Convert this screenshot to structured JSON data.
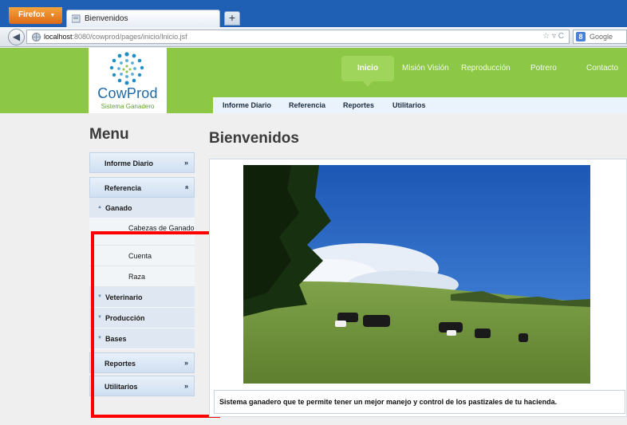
{
  "browser": {
    "app_button": "Firefox",
    "tab_title": "Bienvenidos",
    "new_tab": "+",
    "url_host": "localhost",
    "url_path": ":8080/cowprod/pages/inicio/Inicio.jsf",
    "search_placeholder": "Google"
  },
  "site": {
    "logo_title": "CowProd",
    "logo_subtitle": "Sistema Ganadero",
    "top_nav": [
      "Inicio",
      "Misión Visión",
      "Reproducción",
      "Potrero",
      "Contacto"
    ],
    "sub_nav": [
      "Informe Diario",
      "Referencia",
      "Reportes",
      "Utilitarios"
    ]
  },
  "menu": {
    "title": "Menu",
    "informe_diario": "Informe Diario",
    "referencia": "Referencia",
    "ganado": "Ganado",
    "cabezas_de_ganado": "Cabezas de Ganado",
    "cuenta": "Cuenta",
    "raza": "Raza",
    "veterinario": "Veterinario",
    "produccion": "Producción",
    "bases": "Bases",
    "reportes": "Reportes",
    "utilitarios": "Utilitarios"
  },
  "main": {
    "heading": "Bienvenidos",
    "caption": "Sistema ganadero que te permite tener un mejor manejo y control de los pastizales de tu hacienda."
  },
  "colors": {
    "header_green": "#8cc746",
    "active_tab_green": "#9fd55b",
    "logo_blue": "#1f6aa5",
    "highlight_red": "#ff0000"
  }
}
